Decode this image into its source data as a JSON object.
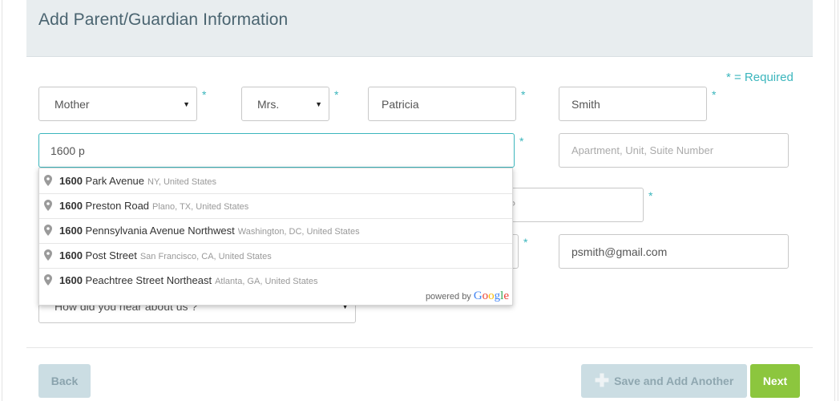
{
  "header": {
    "title": "Add Parent/Guardian Information"
  },
  "required_note": "* = Required",
  "required_star": "*",
  "form": {
    "relationship": {
      "value": "Mother"
    },
    "salutation": {
      "value": "Mrs."
    },
    "first_name": {
      "value": "Patricia"
    },
    "last_name": {
      "value": "Smith"
    },
    "address": {
      "value": "1600 p"
    },
    "address2": {
      "placeholder": "Apartment, Unit, Suite Number"
    },
    "zip": {
      "placeholder": "ZIP"
    },
    "email": {
      "value": "psmith@gmail.com"
    },
    "referral": {
      "value": "How did you hear about us ?"
    }
  },
  "autocomplete": {
    "items": [
      {
        "match": "1600",
        "rest": " Park Avenue",
        "secondary": "NY, United States"
      },
      {
        "match": "1600",
        "rest": " Preston Road",
        "secondary": "Plano, TX, United States"
      },
      {
        "match": "1600",
        "rest": " Pennsylvania Avenue Northwest",
        "secondary": "Washington, DC, United States"
      },
      {
        "match": "1600",
        "rest": " Post Street",
        "secondary": "San Francisco, CA, United States"
      },
      {
        "match": "1600",
        "rest": " Peachtree Street Northeast",
        "secondary": "Atlanta, GA, United States"
      }
    ],
    "powered_by": "powered by",
    "brand": "Google"
  },
  "buttons": {
    "back": "Back",
    "save_add": "Save and Add Another",
    "next": "Next"
  },
  "icons": {
    "plus": "plus-icon",
    "pin": "map-pin-icon",
    "caret": "caret-down-icon"
  },
  "colors": {
    "accent": "#3bb6bd",
    "next_green": "#8cc63e",
    "header_bg": "#e8edef"
  }
}
